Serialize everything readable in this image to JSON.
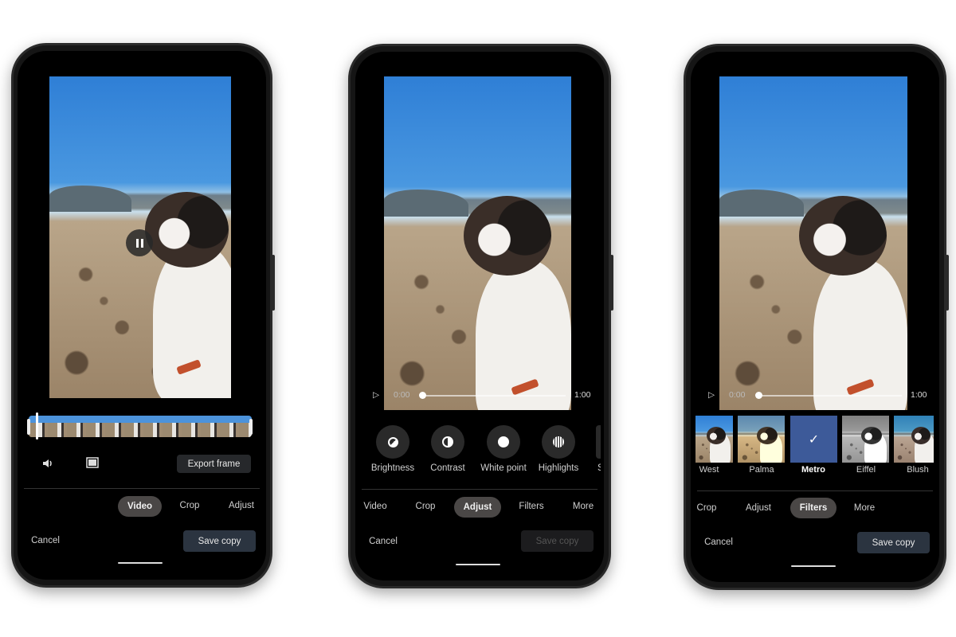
{
  "phones": [
    {
      "mode": "video",
      "toolbar": {
        "export_frame": "Export frame"
      },
      "icons": [
        "volume-icon",
        "frame-icon",
        "pause-icon"
      ],
      "tabs": [
        {
          "label": "Video",
          "active": true
        },
        {
          "label": "Crop",
          "active": false
        },
        {
          "label": "Adjust",
          "active": false
        }
      ],
      "cancel": "Cancel",
      "save": "Save copy"
    },
    {
      "mode": "adjust",
      "player": {
        "current": "0:00",
        "duration": "1:00",
        "progress": 0
      },
      "tools": [
        {
          "label": "Brightness",
          "icon": "brightness-icon"
        },
        {
          "label": "Contrast",
          "icon": "contrast-icon"
        },
        {
          "label": "White point",
          "icon": "white-point-icon"
        },
        {
          "label": "Highlights",
          "icon": "highlights-icon"
        },
        {
          "label": "S"
        }
      ],
      "tabs": [
        {
          "label": "Video"
        },
        {
          "label": "Crop"
        },
        {
          "label": "Adjust",
          "active": true
        },
        {
          "label": "Filters"
        },
        {
          "label": "More"
        }
      ],
      "cancel": "Cancel",
      "save": "Save copy",
      "save_disabled": true
    },
    {
      "mode": "filters",
      "player": {
        "current": "0:00",
        "duration": "1:00",
        "progress": 0
      },
      "filters": [
        {
          "label": "West"
        },
        {
          "label": "Palma"
        },
        {
          "label": "Metro",
          "selected": true
        },
        {
          "label": "Eiffel"
        },
        {
          "label": "Blush"
        }
      ],
      "tabs": [
        {
          "label": "Crop"
        },
        {
          "label": "Adjust"
        },
        {
          "label": "Filters",
          "active": true
        },
        {
          "label": "More"
        }
      ],
      "cancel": "Cancel",
      "save": "Save copy"
    }
  ],
  "colors": {
    "selected_filter": "#3d5a99",
    "save_button": "#2b3440",
    "pill": "#4a4746"
  }
}
